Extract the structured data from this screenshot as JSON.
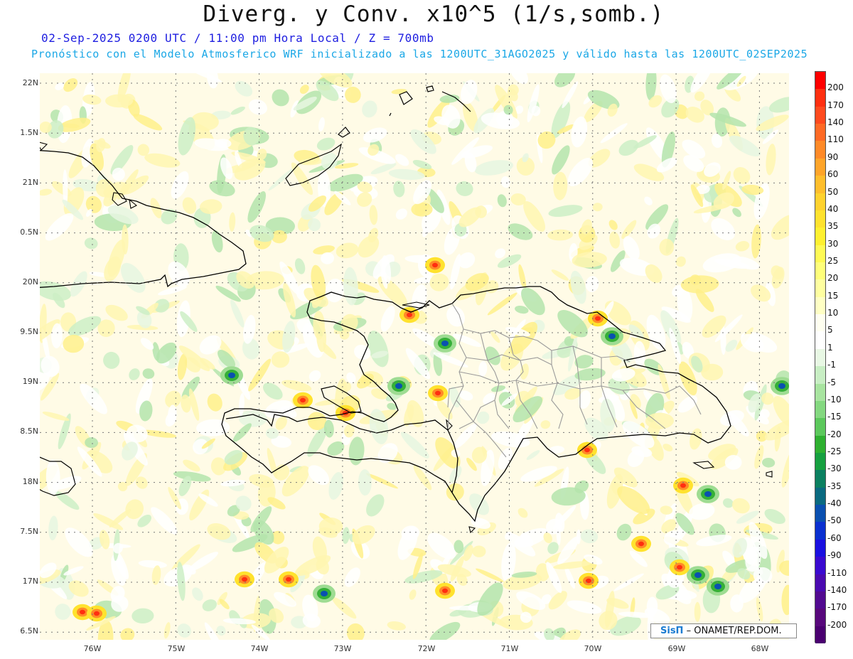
{
  "header": {
    "title": "Diverg. y Conv. x10^5 (1/s,somb.)",
    "subtitle": "02-Sep-2025 0200 UTC / 11:00 pm Hora Local / Z = 700mb",
    "model_line": "Pronóstico con el Modelo Atmosferico WRF inicializado a las 1200UTC_31AGO2025 y válido hasta las  1200UTC_02SEP2025"
  },
  "map": {
    "lat_labels": [
      "22N",
      "1.5N",
      "21N",
      "0.5N",
      "20N",
      "9.5N",
      "19N",
      "8.5N",
      "18N",
      "7.5N",
      "17N",
      "6.5N"
    ],
    "lon_labels": [
      "76W",
      "75W",
      "74W",
      "73W",
      "72W",
      "71W",
      "70W",
      "69W",
      "68W"
    ],
    "background_color": "#fffbe6",
    "coastline_color": "#000000",
    "border_color": "#999999",
    "regions": [
      "Cuba",
      "Haiti",
      "Republica Dominicana",
      "Bahamas",
      "Turks and Caicos",
      "Jamaica"
    ]
  },
  "colorbar": {
    "labels": [
      "200",
      "170",
      "140",
      "110",
      "90",
      "60",
      "50",
      "40",
      "35",
      "30",
      "25",
      "20",
      "15",
      "10",
      "5",
      "1",
      "-1",
      "-5",
      "-10",
      "-15",
      "-20",
      "-25",
      "-30",
      "-35",
      "-40",
      "-50",
      "-60",
      "-90",
      "-110",
      "-140",
      "-170",
      "-200"
    ],
    "colors": [
      "#ff0000",
      "#ff2f10",
      "#ff4a1e",
      "#ff6a25",
      "#ff8a28",
      "#ffa52a",
      "#ffbe2c",
      "#ffd22e",
      "#ffe22e",
      "#fff030",
      "#fffa55",
      "#ffff7a",
      "#ffffa0",
      "#ffffc4",
      "#fffff0",
      "#ffffff",
      "#e8f8e4",
      "#c8eec4",
      "#a8e4a0",
      "#84d880",
      "#5cc85c",
      "#2eb030",
      "#16a040",
      "#0b8060",
      "#0a6a80",
      "#0a50b0",
      "#0a30d0",
      "#1a10e0",
      "#3a0ad0",
      "#4a0ab0",
      "#520a90",
      "#58087c"
    ]
  },
  "credit": {
    "logo": "SisΠ",
    "text": "– ONAMET/REP.DOM."
  }
}
